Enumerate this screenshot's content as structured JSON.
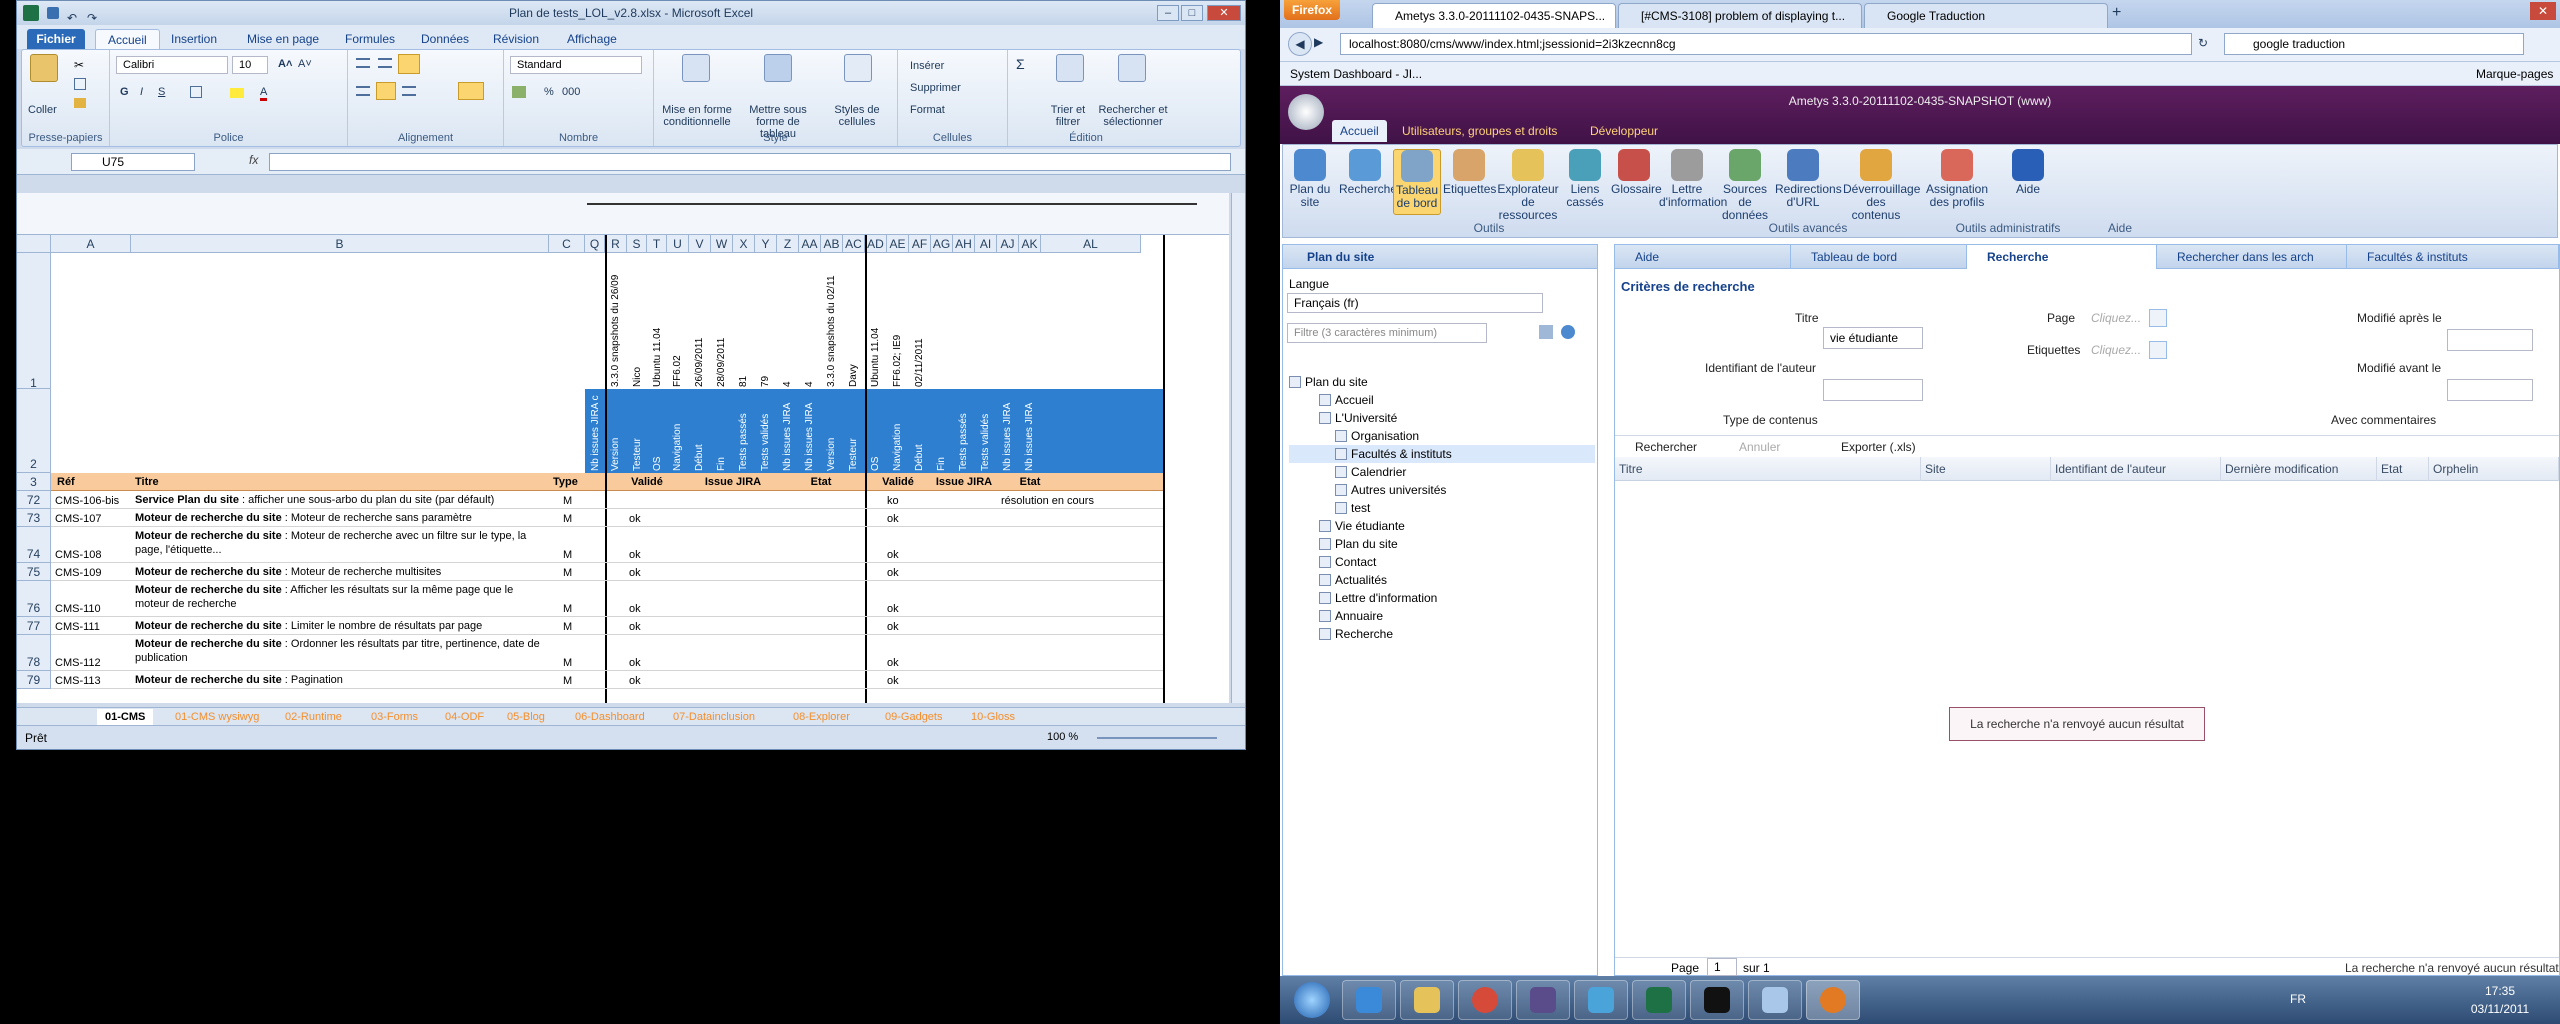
{
  "excel": {
    "title": "Plan de tests_LOL_v2.8.xlsx - Microsoft Excel",
    "tabs": [
      "Fichier",
      "Accueil",
      "Insertion",
      "Mise en page",
      "Formules",
      "Données",
      "Révision",
      "Affichage"
    ],
    "clipboard": {
      "paste": "Coller",
      "group": "Presse-papiers"
    },
    "font": {
      "name": "Calibri",
      "size": "10",
      "group": "Police"
    },
    "alignment_group": "Alignement",
    "number": {
      "format": "Standard",
      "percent": "%",
      "thousands": "000",
      "group": "Nombre"
    },
    "style": {
      "conditional": "Mise en forme conditionnelle",
      "table": "Mettre sous forme de tableau",
      "cell_styles": "Styles de cellules",
      "group": "Style"
    },
    "cells": {
      "insert": "Insérer",
      "delete": "Supprimer",
      "format": "Format",
      "group": "Cellules"
    },
    "edit": {
      "sum": "Σ",
      "sort": "Trier et filtrer",
      "find": "Rechercher et sélectionner",
      "group": "Édition"
    },
    "namebox": "U75",
    "fx": "fx",
    "outline_levels": [
      "1",
      "2"
    ],
    "columns": [
      "A",
      "B",
      "C",
      "Q",
      "R",
      "S",
      "T",
      "U",
      "V",
      "W",
      "X",
      "Y",
      "Z",
      "AA",
      "AB",
      "AC",
      "AD",
      "AE",
      "AF",
      "AG",
      "AH",
      "AI",
      "AJ",
      "AK",
      "AL"
    ],
    "row1_headers": [
      "3.3.0 snapshots du 26/09",
      "Nico",
      "Ubuntu 11.04",
      "FF6.02",
      "26/09/2011",
      "28/09/2011",
      "81",
      "79",
      "4",
      "4",
      "3.3.0 snapshots du 02/11",
      "Davy",
      "Ubuntu 11.04",
      "FF6.02; IE9",
      "02/11/2011"
    ],
    "row2_headers": [
      "Nb issues JIRA c",
      "Version",
      "Testeur",
      "OS",
      "Navigation",
      "Début",
      "Fin",
      "Tests passés",
      "Tests validés",
      "Nb issues JIRA",
      "Nb issues JIRA",
      "Version",
      "Testeur",
      "OS",
      "Navigation",
      "Début",
      "Fin",
      "Tests passés",
      "Tests validés",
      "Nb issues JIRA",
      "Nb issues JIRA"
    ],
    "row3": {
      "ref": "Réf",
      "title": "Titre",
      "type": "Type",
      "groups": [
        "Validé",
        "Issue JIRA",
        "Etat",
        "Validé",
        "Issue JIRA",
        "Etat"
      ]
    },
    "rows": [
      {
        "num": "72",
        "ref": "CMS-106-bis",
        "bold": "Service Plan du site",
        "rest": " : afficher une sous-arbo du plan du site (par défault)",
        "type": "M",
        "v1": "",
        "v2": "ko",
        "etat2": "résolution en cours"
      },
      {
        "num": "73",
        "ref": "CMS-107",
        "bold": "Moteur de recherche du site",
        "rest": " : Moteur de recherche sans paramètre",
        "type": "M",
        "v1": "ok",
        "v2": "ok",
        "etat2": ""
      },
      {
        "num": "74",
        "ref": "CMS-108",
        "bold": "Moteur de recherche du site",
        "rest": " : Moteur de recherche avec un filtre sur le type, la page, l'étiquette...",
        "type": "M",
        "v1": "ok",
        "v2": "ok",
        "etat2": ""
      },
      {
        "num": "75",
        "ref": "CMS-109",
        "bold": "Moteur de recherche du site",
        "rest": " : Moteur de recherche multisites",
        "type": "M",
        "v1": "ok",
        "v2": "ok",
        "etat2": ""
      },
      {
        "num": "76",
        "ref": "CMS-110",
        "bold": "Moteur de recherche du site",
        "rest": " : Afficher les résultats sur la même page que le moteur de recherche",
        "type": "M",
        "v1": "ok",
        "v2": "ok",
        "etat2": ""
      },
      {
        "num": "77",
        "ref": "CMS-111",
        "bold": "Moteur de recherche du site",
        "rest": " : Limiter le nombre de résultats par page",
        "type": "M",
        "v1": "ok",
        "v2": "ok",
        "etat2": ""
      },
      {
        "num": "78",
        "ref": "CMS-112",
        "bold": "Moteur de recherche du site",
        "rest": " : Ordonner les résultats par titre, pertinence, date de publication",
        "type": "M",
        "v1": "ok",
        "v2": "ok",
        "etat2": ""
      },
      {
        "num": "79",
        "ref": "CMS-113",
        "bold": "Moteur de recherche du site",
        "rest": " : Pagination",
        "type": "M",
        "v1": "ok",
        "v2": "ok",
        "etat2": ""
      }
    ],
    "sheets": [
      "01-CMS",
      "01-CMS wysiwyg",
      "02-Runtime",
      "03-Forms",
      "04-ODF",
      "05-Blog",
      "06-Dashboard",
      "07-Datainclusion",
      "08-Explorer",
      "09-Gadgets",
      "10-Gloss"
    ],
    "status": "Prêt",
    "zoom": "100 %"
  },
  "firefox": {
    "menu": "Firefox",
    "tabs": [
      "Ametys 3.3.0-20111102-0435-SNAPS...",
      "[#CMS-3108] problem of displaying t...",
      "Google Traduction"
    ],
    "url": "localhost:8080/cms/www/index.html;jsessionid=2i3kzecnn8cg",
    "search": "google traduction",
    "bookmark": "System Dashboard - JI...",
    "bookmarks_right": "Marque-pages"
  },
  "ametys": {
    "title": "Ametys 3.3.0-20111102-0435-SNAPSHOT (www)",
    "tabs": [
      "Accueil",
      "Utilisateurs, groupes et droits",
      "Développeur"
    ],
    "buttons": [
      {
        "label": "Plan du site",
        "icon": "sitemap-icon"
      },
      {
        "label": "Recherche",
        "icon": "search-icon"
      },
      {
        "label": "Tableau de bord",
        "icon": "dashboard-icon"
      },
      {
        "label": "Etiquettes",
        "icon": "tags-icon"
      },
      {
        "label": "Explorateur de ressources",
        "icon": "folder-icon"
      },
      {
        "label": "Liens cassés",
        "icon": "broken-link-icon"
      },
      {
        "label": "Glossaire",
        "icon": "glossary-icon"
      },
      {
        "label": "Lettre d'information",
        "icon": "newsletter-icon"
      },
      {
        "label": "Sources de données",
        "icon": "datasource-icon"
      },
      {
        "label": "Redirections d'URL",
        "icon": "redirect-icon"
      },
      {
        "label": "Déverrouillage des contenus",
        "icon": "unlock-icon"
      },
      {
        "label": "Assignation des profils",
        "icon": "profiles-icon"
      },
      {
        "label": "Aide",
        "icon": "help-icon"
      }
    ],
    "groups": [
      "Outils",
      "Outils avancés",
      "Outils administratifs",
      "Aide"
    ],
    "sitemap": {
      "title": "Plan du site",
      "lang_label": "Langue",
      "lang_value": "Français (fr)",
      "filter_placeholder": "Filtre (3 caractères minimum)",
      "tree": [
        "Plan du site",
        "Accueil",
        "L'Université",
        "Organisation",
        "Facultés & instituts",
        "Calendrier",
        "Autres universités",
        "test",
        "Vie étudiante",
        "Plan du site",
        "Contact",
        "Actualités",
        "Lettre d'information",
        "Annuaire",
        "Recherche"
      ]
    },
    "right_tabs": [
      "Aide",
      "Tableau de bord",
      "Recherche",
      "Rechercher dans les arch",
      "Facultés & instituts"
    ],
    "criteria": {
      "title": "Critères de recherche",
      "titre_label": "Titre",
      "titre_value": "vie étudiante",
      "page_label": "Page",
      "page_placeholder": "Cliquez...",
      "etiquettes_label": "Etiquettes",
      "etiquettes_placeholder": "Cliquez...",
      "modifie_apres": "Modifié après le",
      "modifie_avant": "Modifié avant le",
      "auteur_label": "Identifiant de l'auteur",
      "type_label": "Type de contenus",
      "comments_label": "Avec commentaires"
    },
    "actions": {
      "search": "Rechercher",
      "cancel": "Annuler",
      "export": "Exporter (.xls)"
    },
    "columns": [
      "Titre",
      "Site",
      "Identifiant de l'auteur",
      "Dernière modification",
      "Etat",
      "Orphelin"
    ],
    "empty_message": "La recherche n'a renvoyé aucun résultat",
    "pager": {
      "page": "Page",
      "current": "1",
      "of": "sur 1"
    },
    "status_message": "La recherche n'a renvoyé aucun résultat"
  },
  "taskbar": {
    "lang": "FR",
    "time": "17:35",
    "date": "03/11/2011"
  }
}
